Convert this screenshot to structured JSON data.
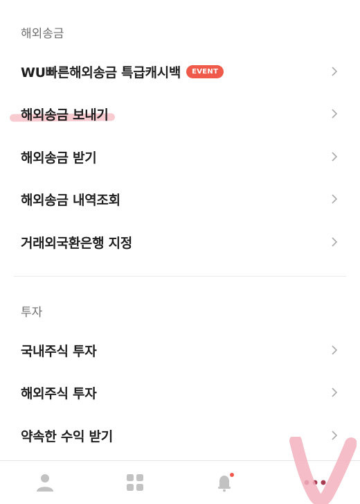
{
  "sections": [
    {
      "header": "해외송금",
      "items": [
        {
          "label": "WU빠른해외송금 특급캐시백",
          "badge": "EVENT"
        },
        {
          "label": "해외송금 보내기"
        },
        {
          "label": "해외송금 받기"
        },
        {
          "label": "해외송금 내역조회"
        },
        {
          "label": "거래외국환은행 지정"
        }
      ]
    },
    {
      "header": "투자",
      "items": [
        {
          "label": "국내주식 투자"
        },
        {
          "label": "해외주식 투자"
        },
        {
          "label": "약속한 수익 받기"
        }
      ]
    }
  ],
  "tabbar": {
    "tabs": [
      {
        "icon": "person-icon"
      },
      {
        "icon": "grid-icon"
      },
      {
        "icon": "bell-icon",
        "has_notification_dot": true
      },
      {
        "icon": "more-icon",
        "selected": true
      }
    ]
  },
  "colors": {
    "accent": "#ef5a4a",
    "highlight": "#f08c96",
    "text": "#1e1e1e",
    "muted": "#6f6f6f",
    "icon": "#c2c2c2",
    "annotation": "#f3b1bd"
  }
}
